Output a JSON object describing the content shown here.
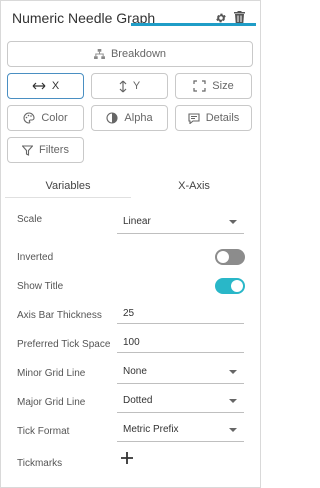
{
  "header": {
    "title": "Numeric Needle Graph"
  },
  "buttons": {
    "breakdown": "Breakdown",
    "x": "X",
    "y": "Y",
    "size": "Size",
    "color": "Color",
    "alpha": "Alpha",
    "details": "Details",
    "filters": "Filters"
  },
  "tabs": [
    {
      "label": "Variables",
      "active": false
    },
    {
      "label": "X-Axis",
      "active": true
    }
  ],
  "settings": {
    "scale": {
      "label": "Scale",
      "value": "Linear"
    },
    "inverted": {
      "label": "Inverted",
      "on": false
    },
    "show_title": {
      "label": "Show Title",
      "on": true
    },
    "axis_bar_thickness": {
      "label": "Axis Bar Thickness",
      "value": "25"
    },
    "preferred_tick_space": {
      "label": "Preferred Tick Space",
      "value": "100"
    },
    "minor_grid_line": {
      "label": "Minor Grid Line",
      "value": "None"
    },
    "major_grid_line": {
      "label": "Major Grid Line",
      "value": "Dotted"
    },
    "tick_format": {
      "label": "Tick Format",
      "value": "Metric Prefix"
    },
    "tickmarks": {
      "label": "Tickmarks"
    }
  },
  "colors": {
    "accent": "#1f9dc7",
    "toggle_on": "#29b7c8",
    "toggle_off": "#8c8c8c",
    "active_border": "#4a8fc2"
  }
}
